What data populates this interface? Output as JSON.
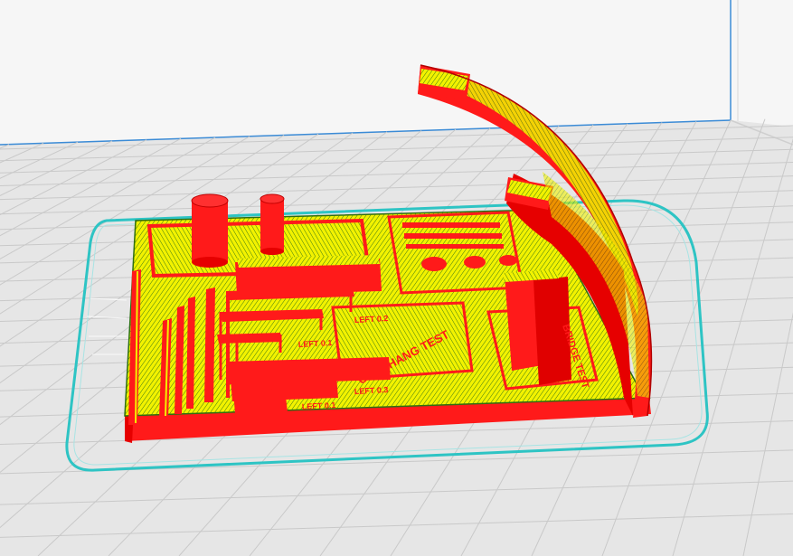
{
  "viewer": {
    "mode": "layer-view",
    "colors": {
      "background_wall": "#f4f4f4",
      "bed_surface": "#e4e4e4",
      "grid_line": "#c8c8c8",
      "axis_line": "#3b8bd6",
      "skirt": "#32c8c8",
      "wall_red": "#ff1a1a",
      "wall_dark_red": "#d40000",
      "infill_yellow": "#f4f400",
      "outline_green": "#2f6e10"
    }
  },
  "model": {
    "labels": {
      "engraved_text_main": "OVERHANG TEST",
      "engraved_text_side": "BRIDGE TEST",
      "legend_row_1": "LEFT 0.2",
      "legend_row_2": "LEFT 0.1",
      "legend_row_3": "LEFT 0.3",
      "legend_row_4": "LEFT 0.1"
    }
  }
}
